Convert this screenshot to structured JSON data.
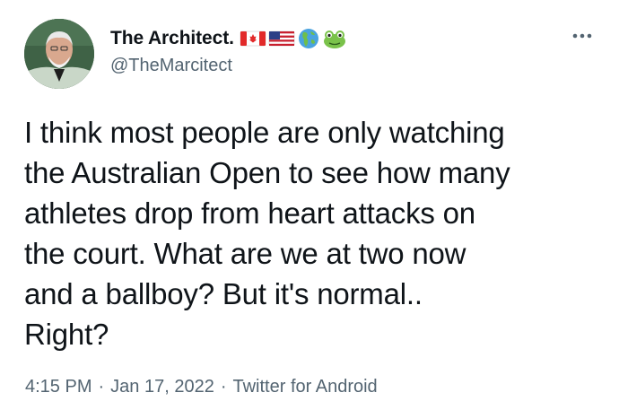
{
  "author": {
    "display_name": "The Architect.",
    "handle": "@TheMarcitect",
    "name_emojis": [
      "canada-flag-icon",
      "usa-flag-icon",
      "globe-americas-icon",
      "frog-icon"
    ]
  },
  "tweet": {
    "text": "I think most people are only watching\nthe Australian Open to see how many\nathletes drop from heart attacks on\nthe court. What are we at two now\nand a ballboy? But it's normal..\nRight?"
  },
  "meta": {
    "time": "4:15 PM",
    "separator1": "·",
    "date": "Jan 17, 2022",
    "separator2": "·",
    "source": "Twitter for Android"
  },
  "colors": {
    "text": "#0f1419",
    "secondary": "#536471",
    "background": "#ffffff"
  },
  "icons": {
    "more": "more-options-icon"
  }
}
